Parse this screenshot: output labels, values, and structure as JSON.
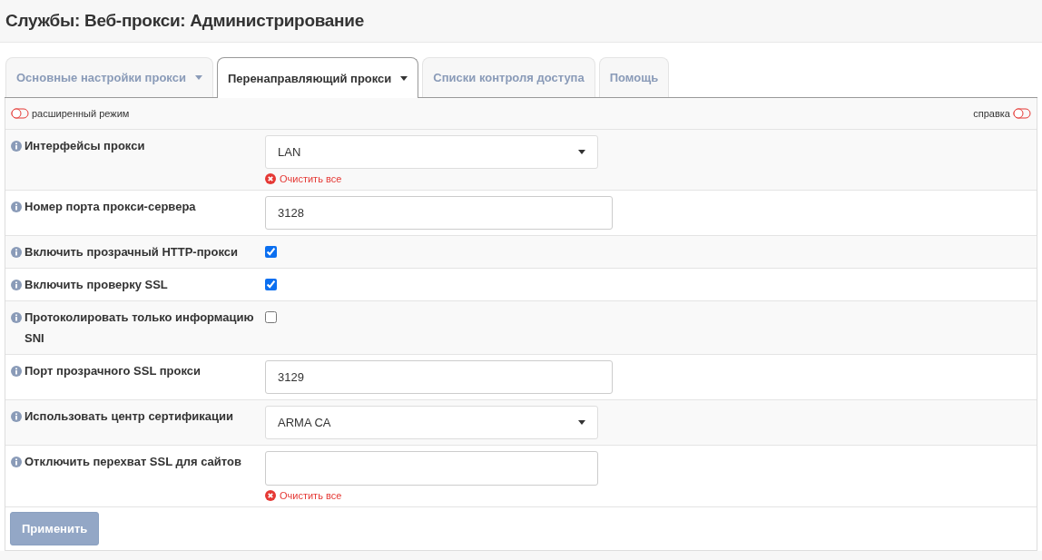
{
  "page_title": "Службы: Веб-прокси: Администрирование",
  "tabs": [
    {
      "label": "Основные настройки прокси",
      "dropdown": true,
      "selected": false
    },
    {
      "label": "Перенаправляющий прокси",
      "dropdown": true,
      "selected": true
    },
    {
      "label": "Списки контроля доступа",
      "dropdown": false,
      "selected": false
    },
    {
      "label": "Помощь",
      "dropdown": false,
      "selected": false
    }
  ],
  "advanced_mode": {
    "label": "расширенный режим",
    "on": false
  },
  "help": {
    "label": "справка",
    "on": false
  },
  "fields": [
    {
      "kind": "select",
      "label": "Интерфейсы прокси",
      "value": "LAN",
      "clear": "Очистить все"
    },
    {
      "kind": "text",
      "label": "Номер порта прокси-сервера",
      "value": "3128"
    },
    {
      "kind": "checkbox",
      "label": "Включить прозрачный HTTP-прокси",
      "checked": true
    },
    {
      "kind": "checkbox",
      "label": "Включить проверку SSL",
      "checked": true
    },
    {
      "kind": "checkbox",
      "label": "Протоколировать только информацию SNI",
      "checked": false
    },
    {
      "kind": "text",
      "label": "Порт прозрачного SSL прокси",
      "value": "3129"
    },
    {
      "kind": "select",
      "label": "Использовать центр сертификации",
      "value": "ARMA CA"
    },
    {
      "kind": "tags",
      "label": "Отключить перехват SSL для сайтов",
      "clear": "Очистить все"
    }
  ],
  "apply_button": "Применить"
}
